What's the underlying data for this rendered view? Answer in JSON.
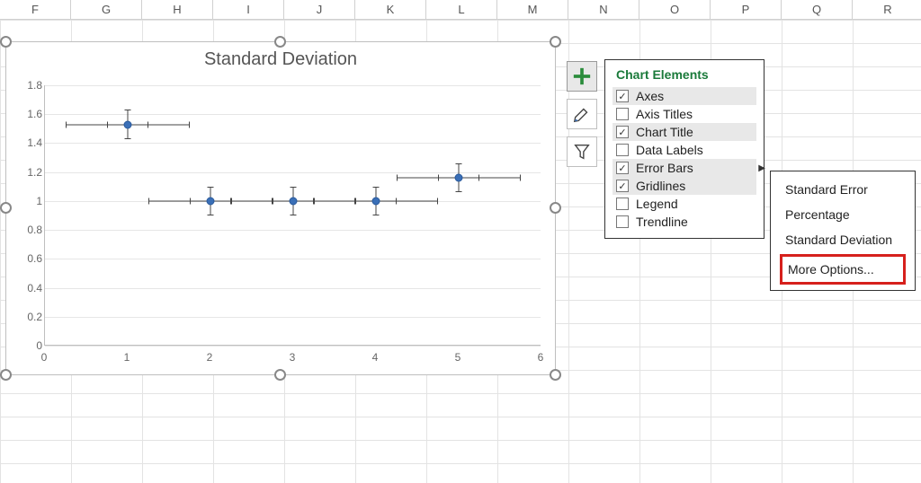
{
  "columns": [
    "F",
    "G",
    "H",
    "I",
    "J",
    "K",
    "L",
    "M",
    "N",
    "O",
    "P",
    "Q",
    "R"
  ],
  "chart_data": {
    "type": "scatter",
    "title": "Standard Deviation",
    "xlim": [
      0,
      6
    ],
    "ylim": [
      0,
      1.8
    ],
    "x_ticks": [
      0,
      1,
      2,
      3,
      4,
      5,
      6
    ],
    "y_ticks": [
      0,
      0.2,
      0.4,
      0.6,
      0.8,
      1,
      1.2,
      1.4,
      1.6,
      1.8
    ],
    "points": [
      {
        "x": 1,
        "y": 1.53
      },
      {
        "x": 2,
        "y": 1.0
      },
      {
        "x": 3,
        "y": 1.0
      },
      {
        "x": 4,
        "y": 1.0
      },
      {
        "x": 5,
        "y": 1.16
      }
    ],
    "error_bars": {
      "y_err": 0.1,
      "x_err": 0.75
    }
  },
  "side_buttons": {
    "plus_tooltip": "Chart Elements",
    "brush_tooltip": "Chart Styles",
    "filter_tooltip": "Chart Filters"
  },
  "chart_elements": {
    "title": "Chart Elements",
    "items": [
      {
        "label": "Axes",
        "checked": true,
        "highlight": true
      },
      {
        "label": "Axis Titles",
        "checked": false,
        "highlight": false
      },
      {
        "label": "Chart Title",
        "checked": true,
        "highlight": true
      },
      {
        "label": "Data Labels",
        "checked": false,
        "highlight": false
      },
      {
        "label": "Error Bars",
        "checked": true,
        "highlight": true,
        "has_arrow": true
      },
      {
        "label": "Gridlines",
        "checked": true,
        "highlight": true
      },
      {
        "label": "Legend",
        "checked": false,
        "highlight": false
      },
      {
        "label": "Trendline",
        "checked": false,
        "highlight": false
      }
    ]
  },
  "error_bar_options": {
    "items": [
      {
        "label": "Standard Error",
        "boxed": false
      },
      {
        "label": "Percentage",
        "boxed": false
      },
      {
        "label": "Standard Deviation",
        "boxed": false
      },
      {
        "label": "More Options...",
        "boxed": true
      }
    ]
  }
}
